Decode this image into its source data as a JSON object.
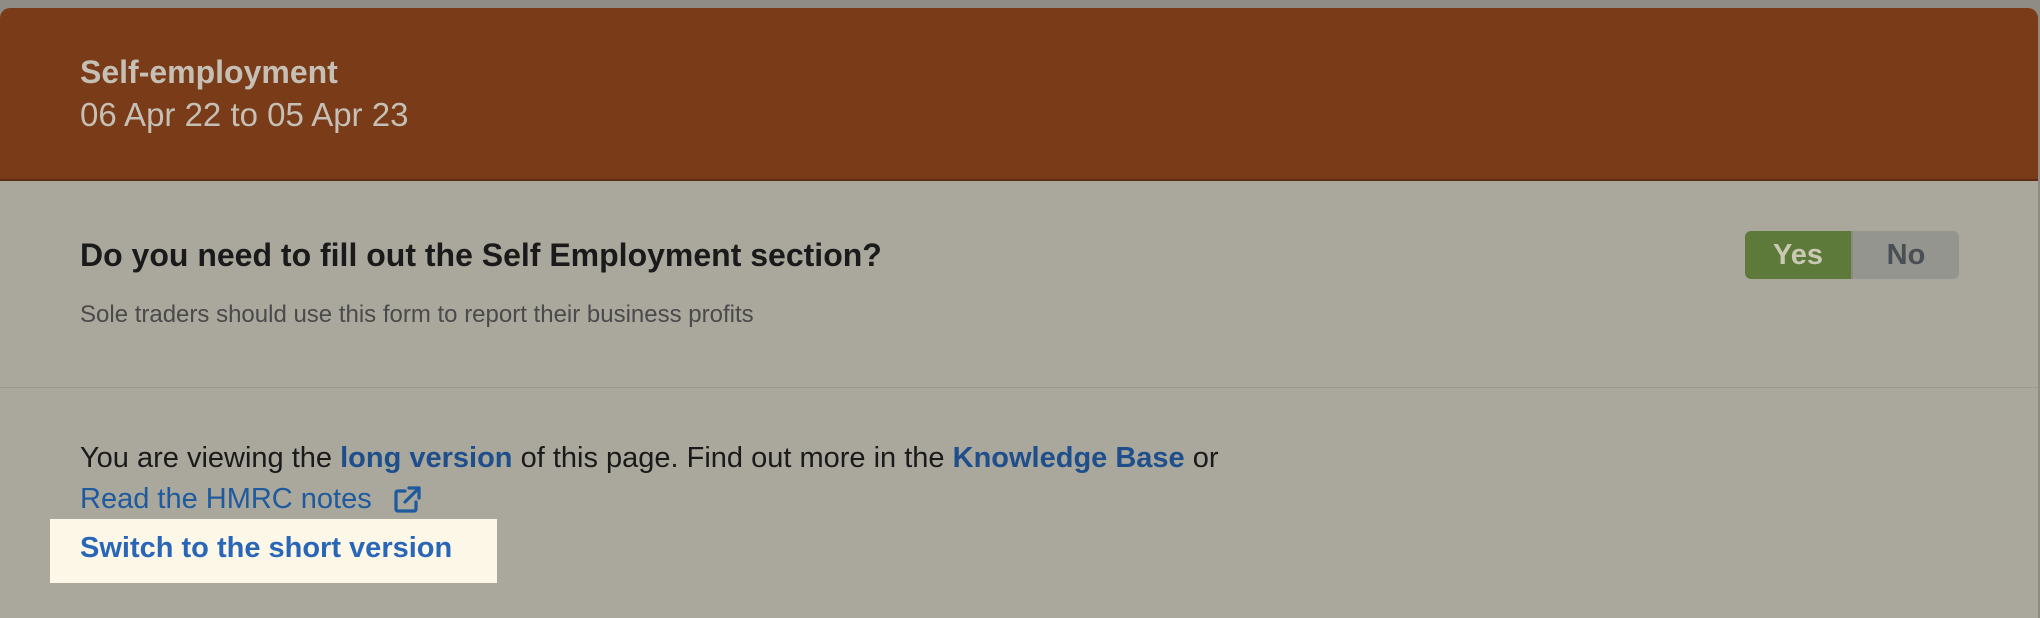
{
  "header": {
    "title": "Self-employment",
    "subtitle": "06 Apr 22 to 05 Apr 23",
    "background_color": "#7a3b18"
  },
  "question": {
    "text": "Do you need to fill out the Self Employment section?",
    "hint": "Sole traders should use this form to report their business profits",
    "toggle": {
      "yes_label": "Yes",
      "no_label": "No",
      "selected": "Yes",
      "yes_color": "#5e7a3a"
    }
  },
  "info": {
    "prefix": "You are viewing the ",
    "long_version_link": "long version",
    "middle": " of this page. Find out more in the ",
    "knowledge_base_link": "Knowledge Base",
    "suffix": " or",
    "hmrc_notes_link": "Read the HMRC notes",
    "hmrc_icon": "external-link-icon",
    "switch_link": "Switch to the short version",
    "link_color": "#1e4f8c"
  }
}
